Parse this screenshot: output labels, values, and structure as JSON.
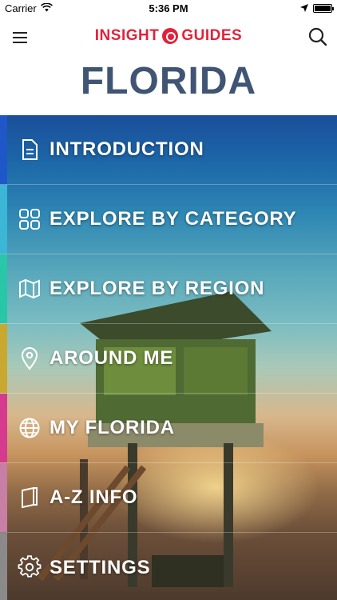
{
  "status_bar": {
    "carrier": "Carrier",
    "time": "5:36 PM",
    "battery_level_percent": 100
  },
  "header": {
    "brand_left": "INSIGHT",
    "brand_right": "GUIDES",
    "title": "FLORIDA",
    "brand_color": "#e2223a",
    "title_color": "#3f5573",
    "menu_icon": "hamburger-icon",
    "search_icon": "search-icon"
  },
  "menu": {
    "items": [
      {
        "label": "INTRODUCTION",
        "icon": "document-icon",
        "accent": "#1f57c8"
      },
      {
        "label": "EXPLORE BY CATEGORY",
        "icon": "grid-icon",
        "accent": "#3bb6d6"
      },
      {
        "label": "EXPLORE BY REGION",
        "icon": "map-icon",
        "accent": "#29c6a8"
      },
      {
        "label": "AROUND ME",
        "icon": "location-pin-icon",
        "accent": "#c8a82f"
      },
      {
        "label": "MY FLORIDA",
        "icon": "globe-icon",
        "accent": "#d63a8e"
      },
      {
        "label": "A-Z INFO",
        "icon": "book-icon",
        "accent": "#c77fa5"
      },
      {
        "label": "SETTINGS",
        "icon": "gear-icon",
        "accent": "#8a8a8a"
      }
    ]
  }
}
